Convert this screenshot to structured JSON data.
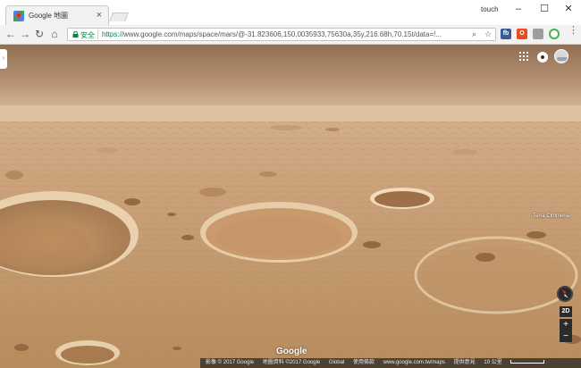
{
  "browser": {
    "tab_title": "Google 地圖",
    "user_name": "touch",
    "secure_label": "安全",
    "url_scheme": "https://",
    "url_rest": "www.google.com/maps/space/mars/@-31.823606,150.0035933,75630a,35y,216.68h,70.15t/data=!...",
    "extensions": [
      {
        "name": "fb-extension",
        "text": "fb",
        "color": "#3b5998"
      },
      {
        "name": "office-extension",
        "text": "O",
        "color": "#e74c1c"
      },
      {
        "name": "gray-extension",
        "text": "",
        "color": "#9e9e9e"
      },
      {
        "name": "chrome-extension",
        "text": "",
        "color": "#4caf50"
      },
      {
        "name": "refresh-extension",
        "text": "",
        "color": "#6d6d6d"
      }
    ]
  },
  "map": {
    "place_label": "Terra Cimmeria",
    "btn_2d": "2D",
    "zoom_in": "+",
    "zoom_out": "−",
    "logo": "Google",
    "footer": {
      "imagery": "影像 © 2017 Google",
      "map_data": "地圖資料 ©2017 Google",
      "global": "Global",
      "terms": "使用條款",
      "url": "www.google.com.tw/maps",
      "feedback": "提供意見",
      "scale": "10 公里"
    }
  },
  "colors": {
    "sky_top": "#9e7c60",
    "horizon": "#d9b48c",
    "ground": "#c89e6c",
    "crater_dark": "#a67a4f",
    "crater_rim": "#ecd2ad",
    "secure_green": "#0b8043"
  }
}
